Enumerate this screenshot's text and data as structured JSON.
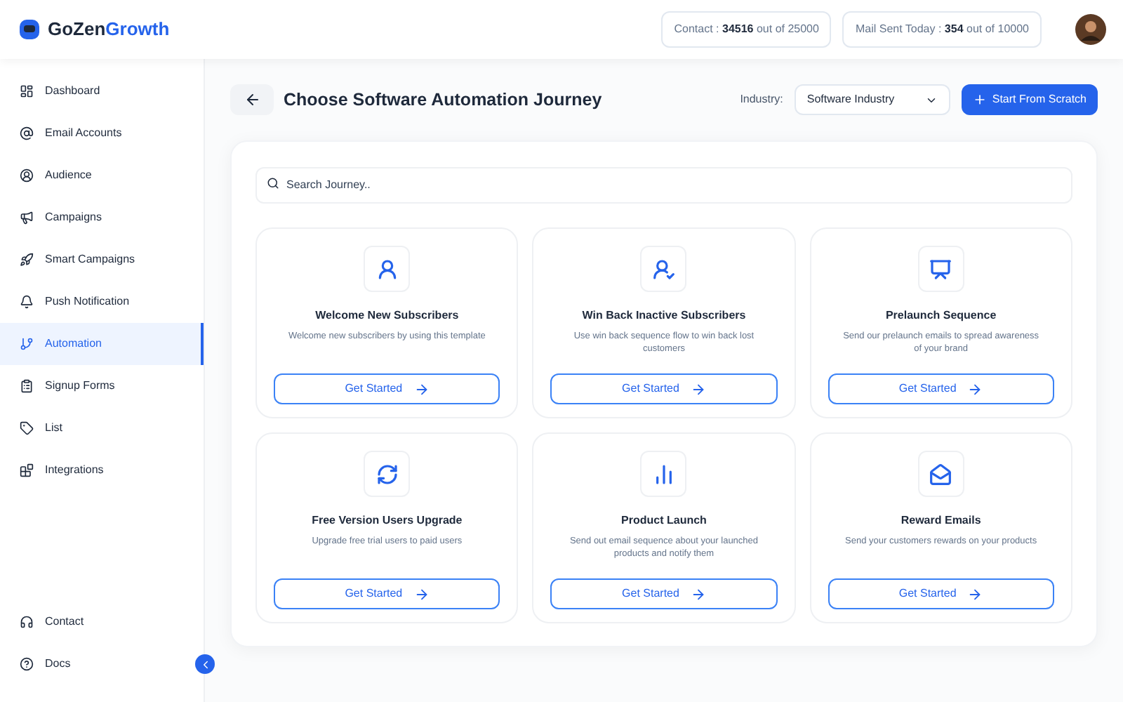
{
  "brand": {
    "part1": "GoZen",
    "part2": "Growth"
  },
  "header": {
    "stats": [
      "Contact : **34516** out of 25000",
      "Mail Sent Today : **354** out of 10000"
    ]
  },
  "sidebar": {
    "items": [
      {
        "label": "Dashboard",
        "selected": false
      },
      {
        "label": "Email Accounts",
        "selected": false
      },
      {
        "label": "Audience",
        "selected": false
      },
      {
        "label": "Campaigns",
        "selected": false
      },
      {
        "label": "Smart Campaigns",
        "selected": false
      },
      {
        "label": "Push Notification",
        "selected": false
      },
      {
        "label": "Automation",
        "selected": true
      },
      {
        "label": "Signup Forms",
        "selected": false
      },
      {
        "label": "List",
        "selected": false
      },
      {
        "label": "Integrations",
        "selected": false
      }
    ],
    "bottom_items": [
      {
        "label": "Contact"
      },
      {
        "label": "Docs"
      }
    ]
  },
  "page": {
    "title": "Choose Software Automation Journey",
    "industry_label": "Industry:",
    "industry_value": "Software Industry",
    "primary_button": "Start From Scratch",
    "search": {
      "placeholder": "Search Journey.."
    }
  },
  "journeys": [
    {
      "title": "Welcome New Subscribers",
      "description": "Welcome new subscribers by using this template",
      "button": "Get Started"
    },
    {
      "title": "Win Back Inactive Subscribers",
      "description": "Use win back sequence flow to win back lost customers",
      "button": "Get Started"
    },
    {
      "title": "Prelaunch Sequence",
      "description": "Send our prelaunch emails to spread awareness of your brand",
      "button": "Get Started"
    },
    {
      "title": "Free Version Users Upgrade",
      "description": "Upgrade free trial users to paid users",
      "button": "Get Started"
    },
    {
      "title": "Product Launch",
      "description": "Send out email sequence about your launched products and notify them",
      "button": "Get Started"
    },
    {
      "title": "Reward Emails",
      "description": "Send your customers rewards on your products",
      "button": "Get Started"
    }
  ]
}
